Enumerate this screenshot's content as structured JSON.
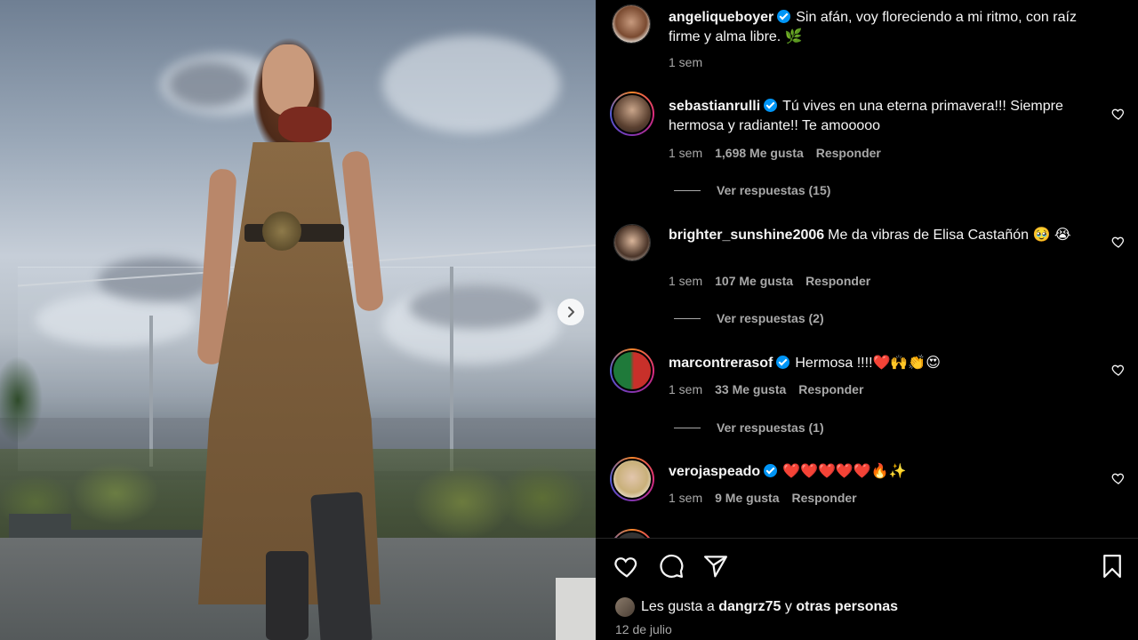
{
  "post": {
    "author": "angeliqueboyer",
    "caption": "Sin afán, voy floreciendo a mi ritmo, con raíz firme y alma libre. 🌿",
    "time": "1 sem"
  },
  "comments": [
    {
      "user": "sebastianrulli",
      "verified": true,
      "text": "Tú vives en una eterna primavera!!! Siempre hermosa y radiante!! Te amooooo",
      "time": "1 sem",
      "likes": "1,698 Me gusta",
      "reply": "Responder",
      "view_replies": "Ver respuestas (15)"
    },
    {
      "user": "brighter_sunshine2006",
      "verified": false,
      "text": "Me da vibras de Elisa Castañón 🥹 😭",
      "time": "1 sem",
      "likes": "107 Me gusta",
      "reply": "Responder",
      "view_replies": "Ver respuestas (2)"
    },
    {
      "user": "marcontrerasof",
      "verified": true,
      "text": "Hermosa !!!!❤️🙌👏😍",
      "time": "1 sem",
      "likes": "33 Me gusta",
      "reply": "Responder",
      "view_replies": "Ver respuestas (1)"
    },
    {
      "user": "verojaspeado",
      "verified": true,
      "text": "❤️❤️❤️❤️❤️🔥✨",
      "time": "1 sem",
      "likes": "9 Me gusta",
      "reply": "Responder"
    }
  ],
  "footer": {
    "likes_prefix": "Les gusta a",
    "liked_by_user": "dangrz75",
    "likes_connector": "y",
    "likes_others": "otras personas",
    "date": "12 de julio"
  },
  "icons": {
    "like": "heart-icon",
    "comment": "comment-icon",
    "share": "send-icon",
    "save": "bookmark-icon",
    "next": "chevron-right-icon"
  },
  "colors": {
    "background": "#000000",
    "text": "#f5f5f5",
    "muted": "#a8a8a8",
    "verified": "#0095f6"
  }
}
